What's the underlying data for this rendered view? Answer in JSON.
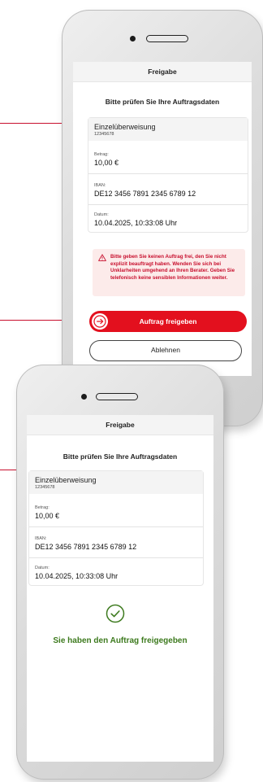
{
  "colors": {
    "accent": "#e3101e",
    "warning_bg": "#fcebea",
    "success": "#3d7a1e"
  },
  "screen1": {
    "header_title": "Freigabe",
    "check_title": "Bitte prüfen Sie Ihre Auftragsdaten",
    "card": {
      "type": "Einzelüberweisung",
      "ref": "12345678",
      "fields": [
        {
          "label": "Betrag:",
          "value": "10,00 €"
        },
        {
          "label": "IBAN:",
          "value": "DE12 3456 7891 2345 6789 12"
        },
        {
          "label": "Datum:",
          "value": "10.04.2025, 10:33:08 Uhr"
        }
      ]
    },
    "warning_text": "Bitte geben Sie keinen Auftrag frei, den Sie nicht explizit beauftragt haben. Wenden Sie sich bei Unklarheiten umgehend an Ihren Berater. Geben Sie telefonisch keine sensiblen Informationen weiter.",
    "approve_label": "Auftrag freigeben",
    "reject_label": "Ablehnen"
  },
  "screen2": {
    "header_title": "Freigabe",
    "check_title": "Bitte prüfen Sie Ihre Auftragsdaten",
    "card": {
      "type": "Einzelüberweisung",
      "ref": "12345678",
      "fields": [
        {
          "label": "Betrag:",
          "value": "10,00 €"
        },
        {
          "label": "IBAN:",
          "value": "DE12 3456 7891 2345 6789 12"
        },
        {
          "label": "Datum:",
          "value": "10.04.2025, 10:33:08 Uhr"
        }
      ]
    },
    "success_text": "Sie haben den Auftrag freigegeben"
  }
}
